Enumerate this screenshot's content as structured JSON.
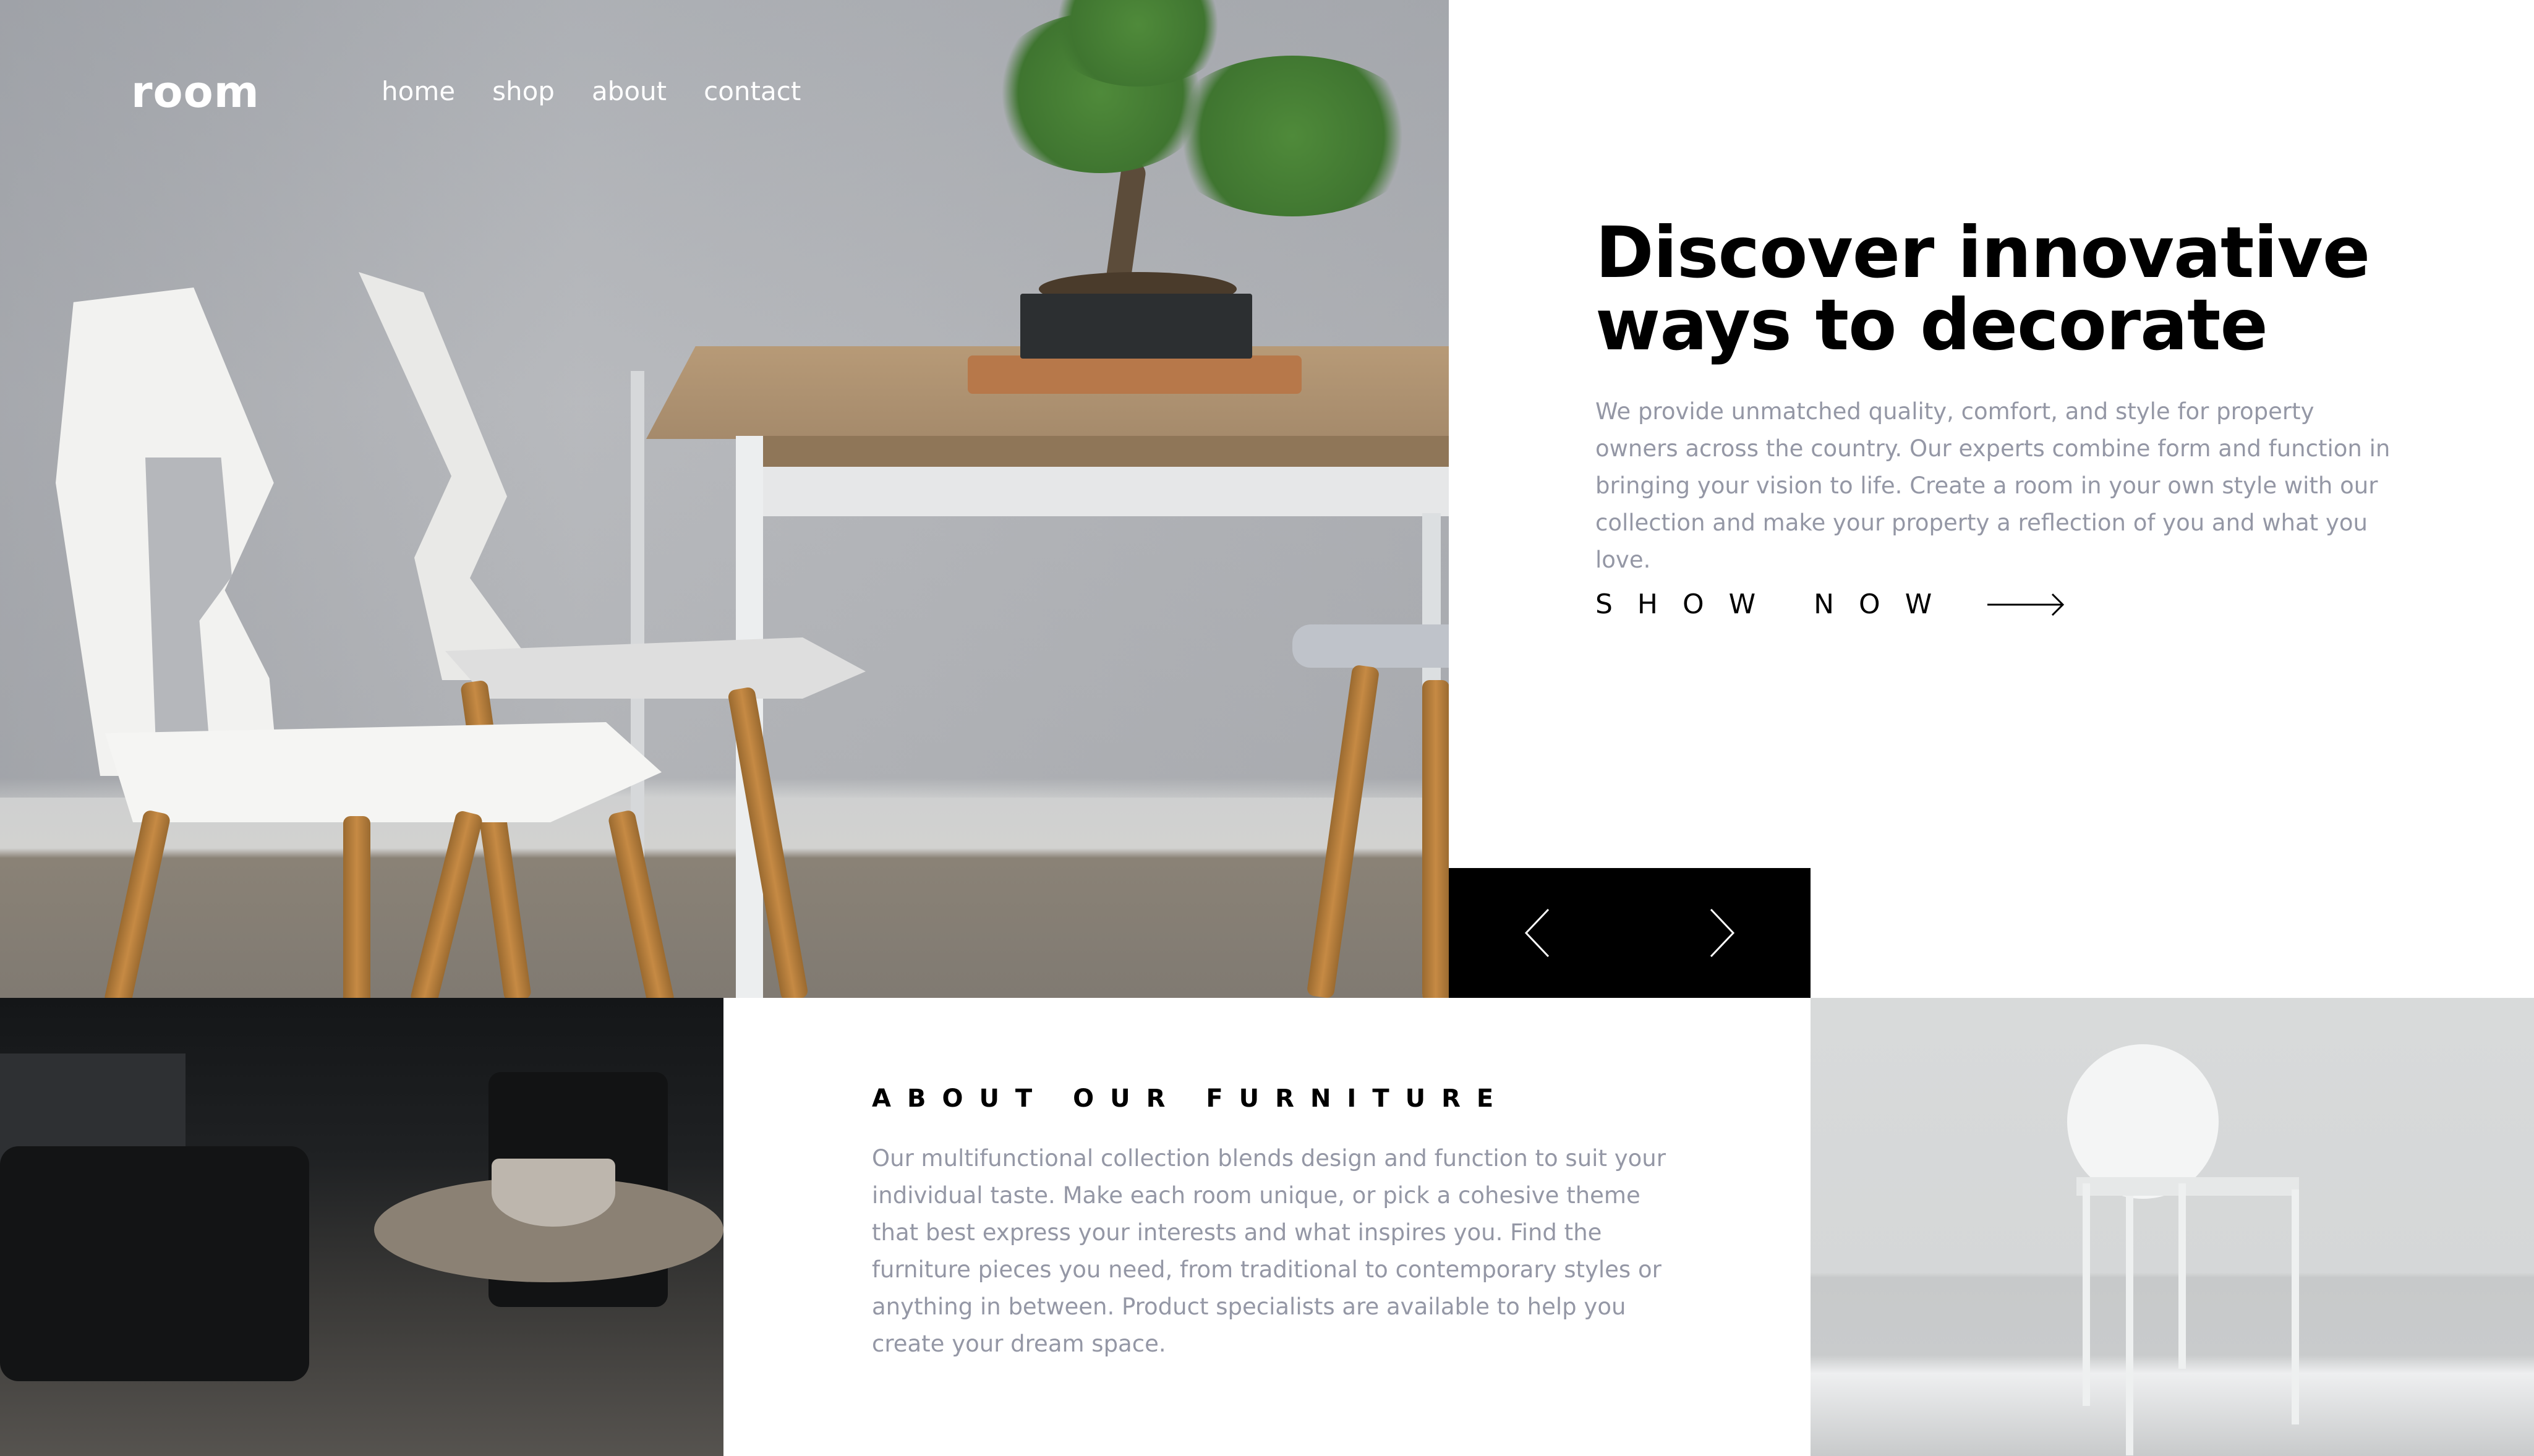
{
  "brand": {
    "logo": "room"
  },
  "nav": {
    "items": [
      {
        "label": "home"
      },
      {
        "label": "shop"
      },
      {
        "label": "about"
      },
      {
        "label": "contact"
      }
    ]
  },
  "hero": {
    "headline": "Discover innovative ways to decorate",
    "description": "We provide unmatched quality, comfort, and style for property owners across the country. Our experts combine form and function in bringing your vision to life. Create a room in your own style with our collection and make your property a reflection of you and what you love.",
    "cta_label": "SHOW NOW",
    "cta_icon": "arrow-right-icon",
    "image_alt": "White chairs at a wooden table with a bonsai tree"
  },
  "slider": {
    "prev_icon": "chevron-left-icon",
    "next_icon": "chevron-right-icon"
  },
  "about": {
    "title": "ABOUT OUR FURNITURE",
    "text": "Our multifunctional collection blends design and function to suit your individual taste. Make each room unique, or pick a cohesive theme that best express your interests and what inspires you. Find the furniture pieces you need, from traditional to contemporary styles or anything in between. Product specialists are available to help you create your dream space.",
    "image_dark_alt": "Dark room with armchairs and round coffee table",
    "image_light_alt": "White chair in a bright room"
  },
  "colors": {
    "text_primary": "#000000",
    "text_muted": "#9497a5",
    "background": "#ffffff",
    "slider_bg": "#000000"
  }
}
